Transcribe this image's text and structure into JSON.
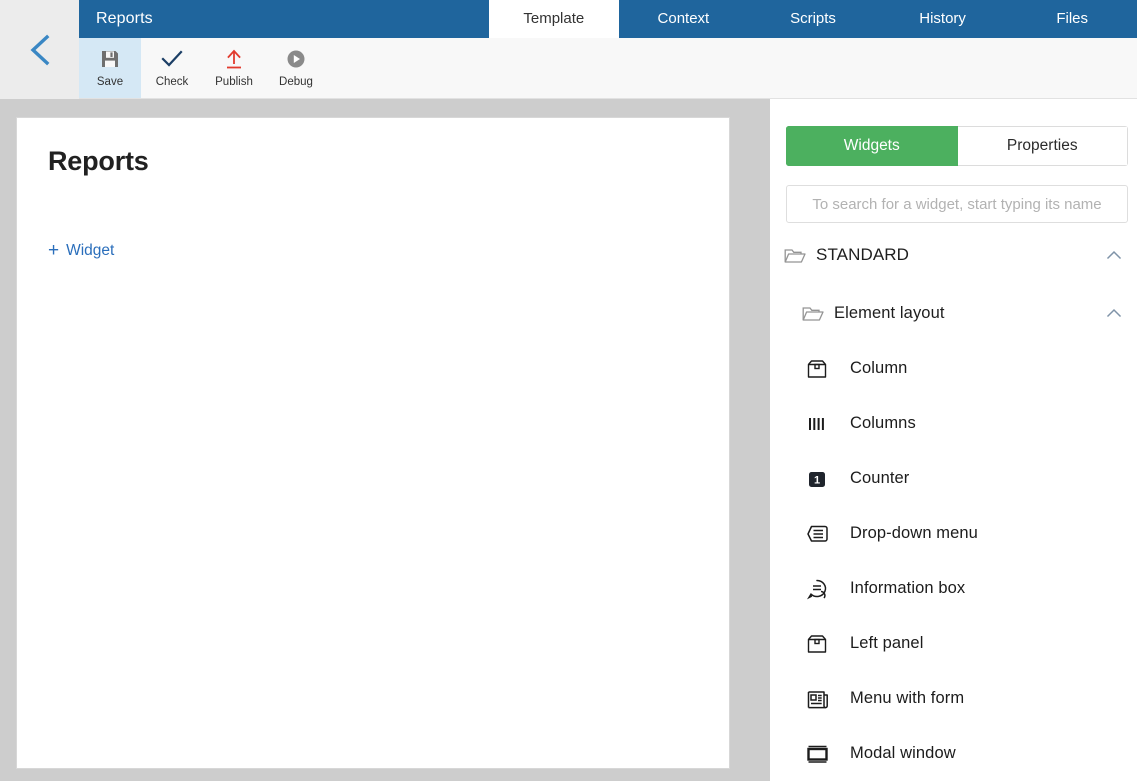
{
  "header": {
    "title": "Reports",
    "back_icon": "chevron-left-icon",
    "tabs": [
      {
        "label": "Template",
        "active": true
      },
      {
        "label": "Context",
        "active": false
      },
      {
        "label": "Scripts",
        "active": false
      },
      {
        "label": "History",
        "active": false
      },
      {
        "label": "Files",
        "active": false
      }
    ]
  },
  "toolbar": {
    "items": [
      {
        "label": "Save",
        "icon": "floppy-disk-icon",
        "selected": true
      },
      {
        "label": "Check",
        "icon": "checkmark-icon",
        "selected": false
      },
      {
        "label": "Publish",
        "icon": "upload-arrow-icon",
        "selected": false
      },
      {
        "label": "Debug",
        "icon": "play-circle-icon",
        "selected": false
      }
    ]
  },
  "canvas": {
    "title": "Reports",
    "add_widget_label": "Widget",
    "add_widget_plus": "+"
  },
  "panel": {
    "segments": [
      {
        "label": "Widgets",
        "active": true
      },
      {
        "label": "Properties",
        "active": false
      }
    ],
    "search": {
      "placeholder": "To search for a widget, start typing its name",
      "value": ""
    },
    "groups": [
      {
        "label": "STANDARD",
        "icon": "folder-open-icon",
        "chevron": "chevron-up-icon",
        "expanded": true
      },
      {
        "label": "Element layout",
        "icon": "folder-open-icon",
        "chevron": "chevron-up-icon",
        "expanded": true
      }
    ],
    "widgets": [
      {
        "label": "Column",
        "icon": "box-icon"
      },
      {
        "label": "Columns",
        "icon": "vertical-bars-icon"
      },
      {
        "label": "Counter",
        "icon": "number-one-badge-icon"
      },
      {
        "label": "Drop-down menu",
        "icon": "dropdown-list-icon"
      },
      {
        "label": "Information box",
        "icon": "speech-bubble-info-icon"
      },
      {
        "label": "Left panel",
        "icon": "box-icon"
      },
      {
        "label": "Menu with form",
        "icon": "newspaper-icon"
      },
      {
        "label": "Modal window",
        "icon": "modal-window-icon"
      }
    ]
  },
  "colors": {
    "header_blue": "#1f659d",
    "accent_green": "#4cb05f",
    "link_blue": "#2a6ebb",
    "selected_tool": "#d5e8f5",
    "workspace_gray": "#cdcdcd",
    "publish_red": "#e23b2e"
  }
}
